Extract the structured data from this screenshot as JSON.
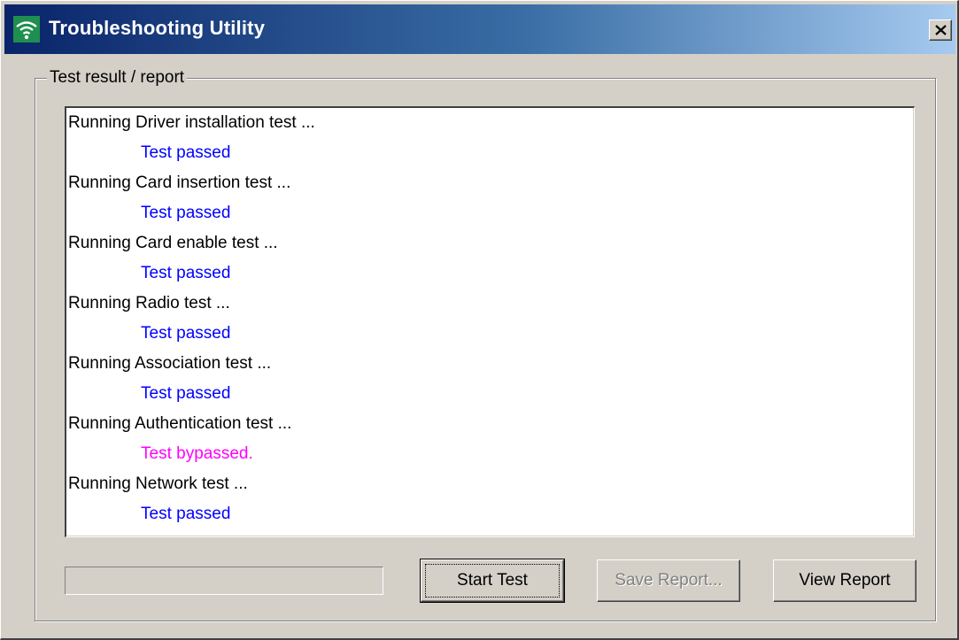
{
  "window": {
    "title": "Troubleshooting Utility"
  },
  "group": {
    "label": "Test result / report"
  },
  "log": [
    {
      "text": "Running Driver installation test ...",
      "kind": "step"
    },
    {
      "text": "Test passed",
      "kind": "passed"
    },
    {
      "text": "Running Card insertion test ...",
      "kind": "step"
    },
    {
      "text": "Test passed",
      "kind": "passed"
    },
    {
      "text": "Running Card enable test ...",
      "kind": "step"
    },
    {
      "text": "Test passed",
      "kind": "passed"
    },
    {
      "text": "Running Radio test ...",
      "kind": "step"
    },
    {
      "text": "Test passed",
      "kind": "passed"
    },
    {
      "text": "Running Association test ...",
      "kind": "step"
    },
    {
      "text": "Test passed",
      "kind": "passed"
    },
    {
      "text": "Running Authentication test ...",
      "kind": "step"
    },
    {
      "text": "Test bypassed.",
      "kind": "bypassed"
    },
    {
      "text": "Running Network test ...",
      "kind": "step"
    },
    {
      "text": "Test passed",
      "kind": "passed"
    }
  ],
  "colors": {
    "step": "#000000",
    "passed": "#0000ff",
    "bypassed": "#ff00ff"
  },
  "progress": {
    "percent": 0
  },
  "buttons": {
    "start_test": "Start Test",
    "save_report": "Save Report...",
    "view_report": "View Report"
  },
  "icons": {
    "app": "wifi-signal-icon",
    "close": "close-icon"
  }
}
